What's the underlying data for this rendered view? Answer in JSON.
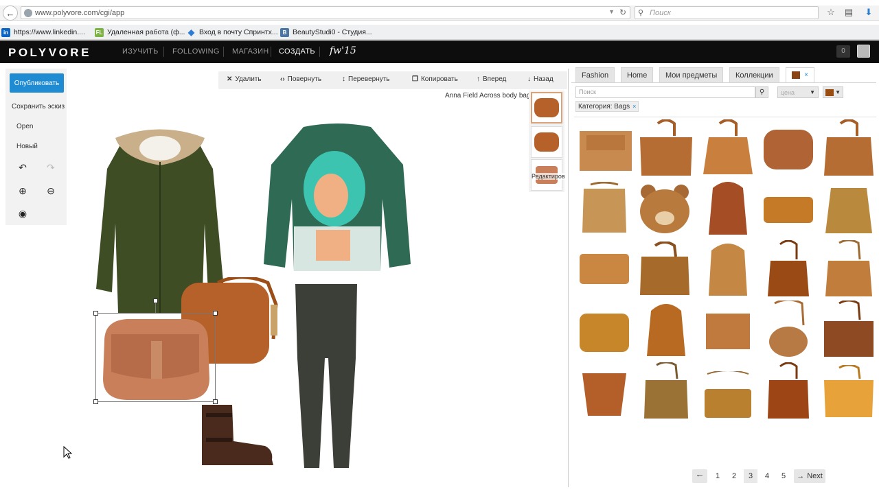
{
  "browser": {
    "url": "www.polyvore.com/cgi/app",
    "search_placeholder": "Поиск",
    "bookmarks": [
      {
        "label": "https://www.linkedin....",
        "icon": "in",
        "color": "#0a66c2"
      },
      {
        "label": "Удаленная работа (ф...",
        "icon": "FL",
        "color": "#7cb342"
      },
      {
        "label": "Вход в почту Спринтх...",
        "icon": "◆",
        "color": "#2e7bd6"
      },
      {
        "label": "BeautyStudi0 - Студия...",
        "icon": "B",
        "color": "#4c75a3"
      }
    ]
  },
  "nav": {
    "logo": "POLYVORE",
    "items": [
      "ИЗУЧИТЬ",
      "FOLLOWING",
      "МАГАЗИН",
      "СОЗДАТЬ"
    ],
    "active_item": "СОЗДАТЬ",
    "badge": "fw'15",
    "notification_count": "0"
  },
  "tools": {
    "publish": "Опубликовать",
    "save_draft": "Сохранить эскиз",
    "open": "Open",
    "new": "Новый"
  },
  "canvas_toolbar": {
    "delete": "Удалить",
    "rotate": "Повернуть",
    "flip": "Перевернуть",
    "copy": "Копировать",
    "forward": "Вперед",
    "back": "Назад"
  },
  "selected_item": {
    "name": "Anna Field Across body bag",
    "layer_label": "Редактиров"
  },
  "right_panel": {
    "tabs": [
      "Fashion",
      "Home",
      "Мои предметы",
      "Коллекции"
    ],
    "active_color_tab": "#8b4513",
    "search_placeholder": "Поиск",
    "price_label": "цена",
    "filter_color": "#9a4d10",
    "category_chip": "Категория: Bags",
    "pagination": {
      "pages": [
        "1",
        "2",
        "3",
        "4",
        "5"
      ],
      "current": "3",
      "next": "Next"
    }
  },
  "colors": {
    "accent": "#1f8bd2",
    "nav_bg": "#0d0d0d"
  }
}
